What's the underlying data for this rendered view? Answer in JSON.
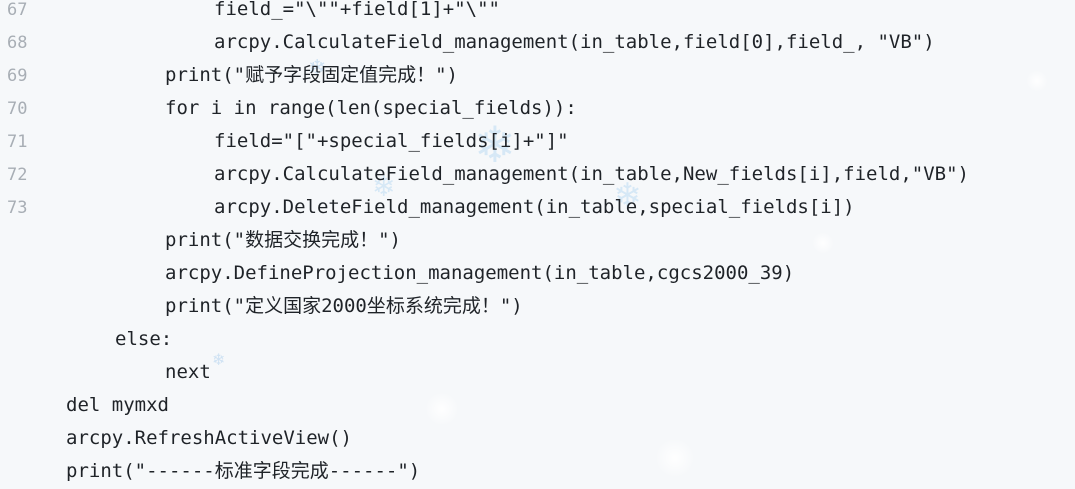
{
  "line_numbers": [
    "67",
    "68",
    "69",
    "70",
    "71",
    "72",
    "73"
  ],
  "code_lines": [
    "field_=\"\\\"\"+field[1]+\"\\\"\"",
    "arcpy.CalculateField_management(in_table,field[0],field_, \"VB\")",
    "print(\"赋予字段固定值完成！\")",
    "for i in range(len(special_fields)):",
    "field=\"[\"+special_fields[i]+\"]\"",
    "arcpy.CalculateField_management(in_table,New_fields[i],field,\"VB\")",
    "arcpy.DeleteField_management(in_table,special_fields[i])",
    "print(\"数据交换完成！\")",
    "arcpy.DefineProjection_management(in_table,cgcs2000_39)",
    "print(\"定义国家2000坐标系统完成！\")",
    "else:",
    "next",
    "del mymxd",
    "arcpy.RefreshActiveView()",
    "print(\"------标准字段完成------\")"
  ],
  "decor": {
    "snowflake_icon": "❄",
    "snow_color": "#c9dff2"
  }
}
